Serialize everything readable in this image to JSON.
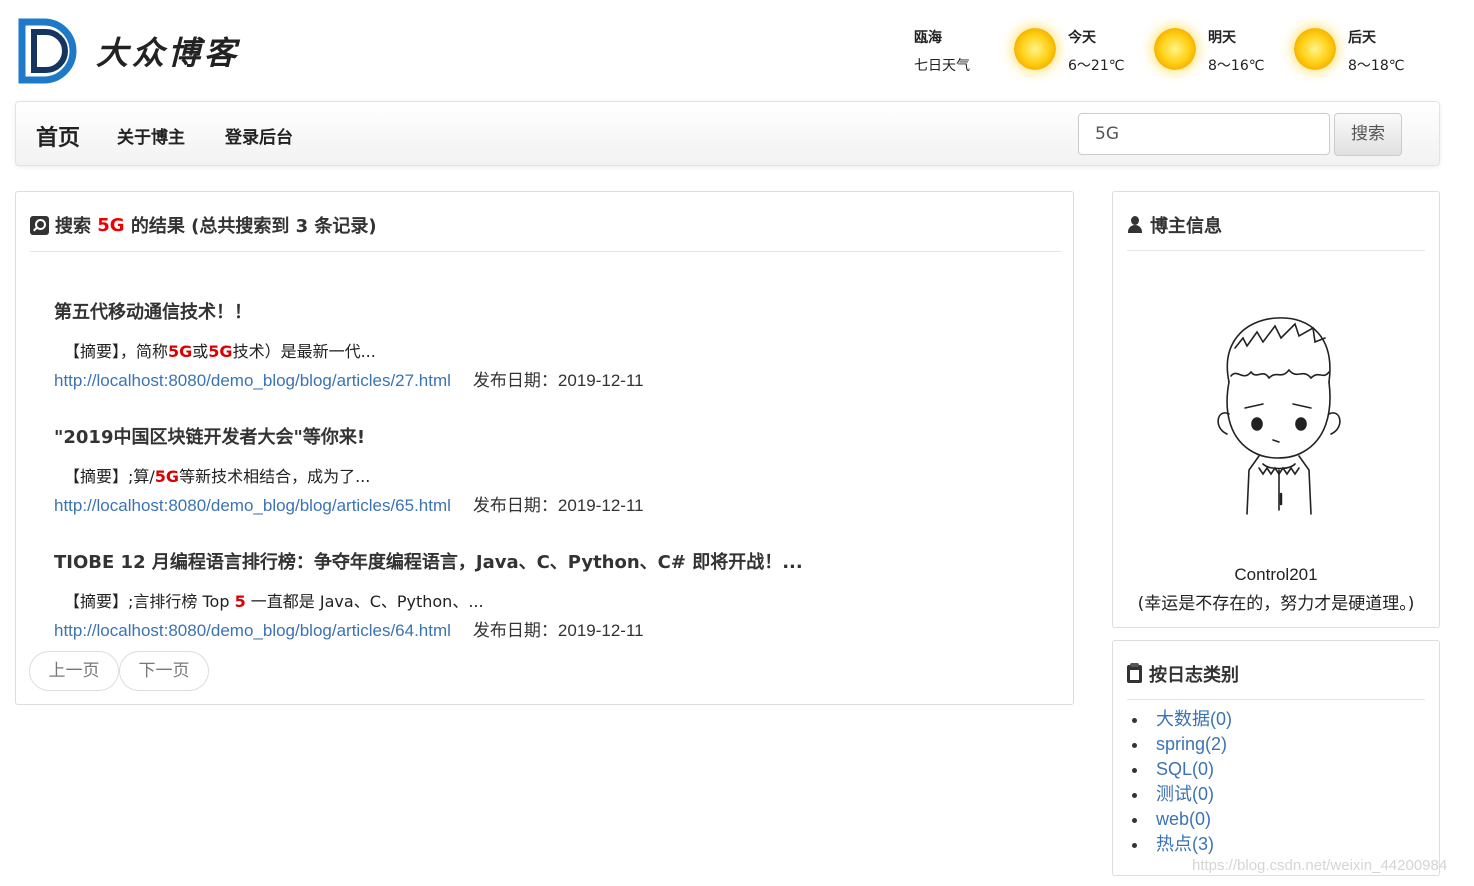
{
  "brand": {
    "logo_text": "大众博客"
  },
  "weather": {
    "location": "瓯海",
    "subtitle": "七日天气",
    "days": [
      {
        "name": "今天",
        "range": "6～21℃",
        "icon": "sun-icon"
      },
      {
        "name": "明天",
        "range": "8～16℃",
        "icon": "sun-icon"
      },
      {
        "name": "后天",
        "range": "8～18℃",
        "icon": "sun-icon"
      }
    ]
  },
  "nav": {
    "home": "首页",
    "items": [
      "关于博主",
      "登录后台"
    ],
    "search_value": "5G",
    "search_button": "搜索"
  },
  "results": {
    "heading_prefix": "搜索",
    "keyword": "5G",
    "heading_suffix": "的结果 (总共搜索到 3 条记录)",
    "items": [
      {
        "title": "第五代移动通信技术！！",
        "summary_parts": [
          "【摘要】，简称",
          "5G",
          "或",
          "5G",
          "技术）是最新一代..."
        ],
        "url": "http://localhost:8080/demo_blog/blog/articles/27.html",
        "date": "发布日期：2019-12-11"
      },
      {
        "title": "\"2019中国区块链开发者大会\"等你来!",
        "summary_parts": [
          "【摘要】;算/",
          "5G",
          "等新技术相结合，成为了..."
        ],
        "url": "http://localhost:8080/demo_blog/blog/articles/65.html",
        "date": "发布日期：2019-12-11"
      },
      {
        "title": "TIOBE 12 月编程语言排行榜：争夺年度编程语言，Java、C、Python、C# 即将开战！...",
        "summary_parts": [
          "【摘要】;言排行榜 Top ",
          "5",
          " 一直都是 Java、C、Python、..."
        ],
        "url": "http://localhost:8080/demo_blog/blog/articles/64.html",
        "date": "发布日期：2019-12-11"
      }
    ],
    "pager": {
      "prev": "上一页",
      "next": "下一页"
    }
  },
  "blogger": {
    "heading": "博主信息",
    "name": "Control201",
    "motto": "(幸运是不存在的，努力才是硬道理。)"
  },
  "categories": {
    "heading": "按日志类别",
    "items": [
      "大数据(0)",
      "spring(2)",
      "SQL(0)",
      "测试(0)",
      "web(0)",
      "热点(3)"
    ]
  },
  "watermark": "https://blog.csdn.net/weixin_44200984",
  "colors": {
    "link": "#3b73b5",
    "highlight": "#e00000",
    "logo_blue": "#1e7ac8"
  }
}
